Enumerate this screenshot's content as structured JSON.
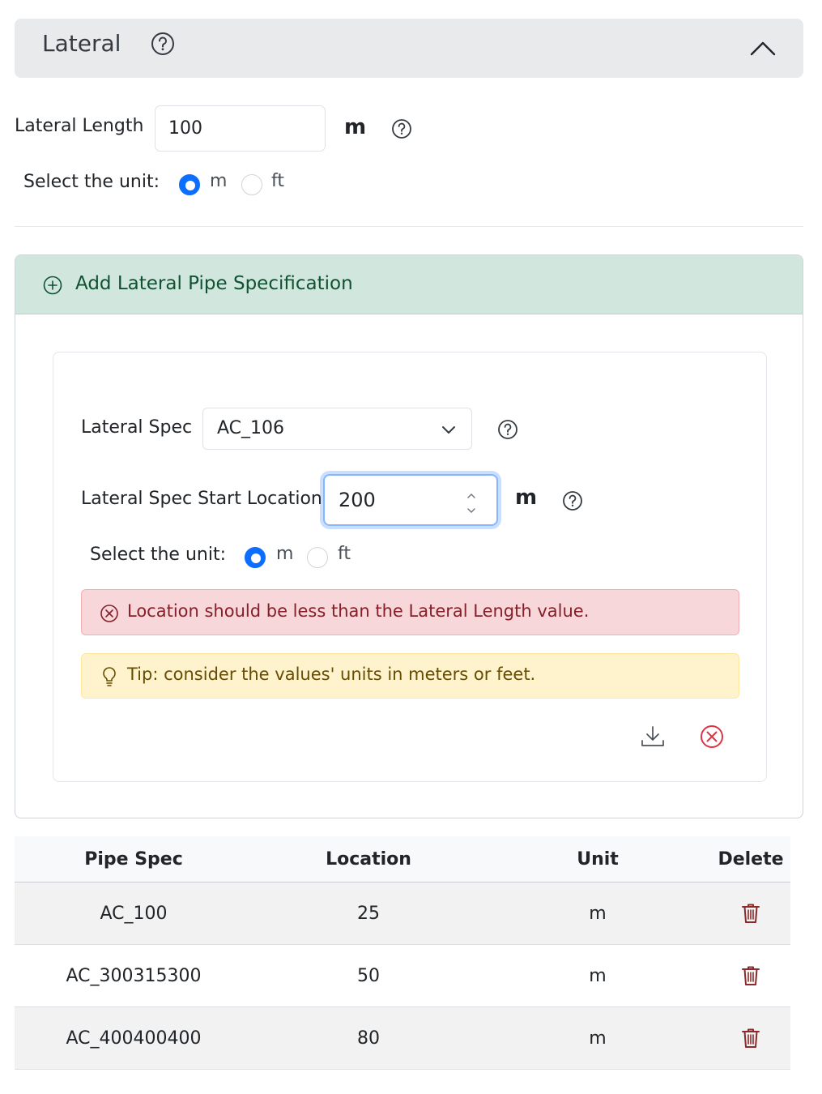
{
  "header": {
    "title": "Lateral",
    "help_icon": "question-circle-icon",
    "collapse_icon": "chevron-up-icon"
  },
  "lateral_length": {
    "label": "Lateral Length",
    "value": "100",
    "unit": "m"
  },
  "unit_select_1": {
    "label": "Select the unit:",
    "options": [
      "m",
      "ft"
    ],
    "selected": "m"
  },
  "add_spec": {
    "title": "Add Lateral Pipe Specification",
    "icon": "plus-circle-icon",
    "spec_label": "Lateral Spec",
    "spec_value": "AC_106",
    "start_label": "Lateral Spec Start Location",
    "start_value": "200",
    "start_unit": "m",
    "unit_label": "Select the unit:",
    "unit_options": [
      "m",
      "ft"
    ],
    "unit_selected": "m",
    "error_text": "Location should be less than the Lateral Length value.",
    "tip_text": "Tip: consider the values' units in meters or feet.",
    "save_icon": "download-icon",
    "cancel_icon": "x-circle-icon"
  },
  "table": {
    "headers": [
      "Pipe Spec",
      "Location",
      "Unit",
      "Delete"
    ],
    "rows": [
      {
        "spec": "AC_100",
        "location": "25",
        "unit": "m"
      },
      {
        "spec": "AC_300315300",
        "location": "50",
        "unit": "m"
      },
      {
        "spec": "AC_400400400",
        "location": "80",
        "unit": "m"
      }
    ],
    "delete_icon": "trash-icon"
  },
  "colors": {
    "accent": "#0d6efd",
    "success_bg": "#d1e7dd",
    "danger_bg": "#f8d7da",
    "danger_text": "#842029",
    "warning_bg": "#fff3cd",
    "warning_text": "#664d03",
    "delete_icon": "#8b2a2a"
  }
}
